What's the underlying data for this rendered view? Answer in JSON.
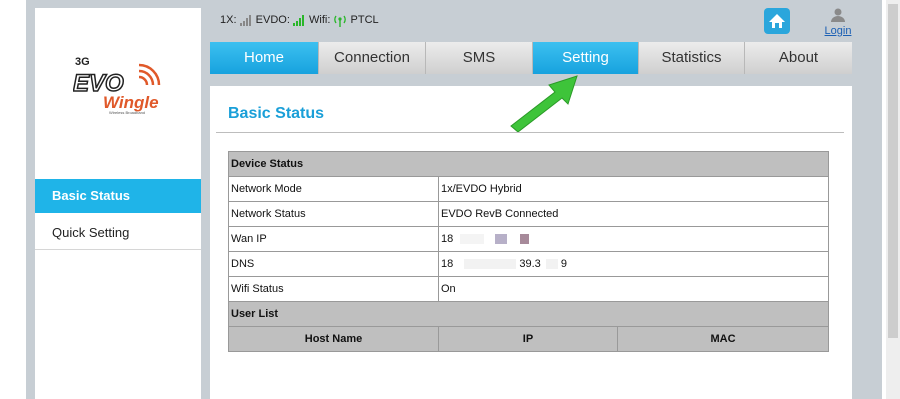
{
  "status": {
    "network_1x_label": "1X:",
    "evdo_label": "EVDO:",
    "wifi_label": "Wifi:",
    "operator": "PTCL",
    "login_label": "Login"
  },
  "logo": {
    "top_text": "3G",
    "main_text": "EVO",
    "sub_text": "Wingle",
    "tagline": "Wireless Broadband"
  },
  "sidebar": {
    "items": [
      {
        "label": "Basic Status"
      },
      {
        "label": "Quick Setting"
      }
    ]
  },
  "nav": {
    "tabs": [
      {
        "label": "Home"
      },
      {
        "label": "Connection"
      },
      {
        "label": "SMS"
      },
      {
        "label": "Setting"
      },
      {
        "label": "Statistics"
      },
      {
        "label": "About"
      }
    ]
  },
  "page": {
    "title": "Basic Status"
  },
  "device_status": {
    "section_title": "Device Status",
    "rows": [
      {
        "label": "Network Mode",
        "value": "1x/EVDO Hybrid"
      },
      {
        "label": "Network Status",
        "value": "EVDO RevB Connected"
      },
      {
        "label": "Wan IP",
        "value": "18"
      },
      {
        "label": "DNS",
        "value": "18",
        "value_part2": "39.3",
        "value_part3": "9"
      },
      {
        "label": "Wifi Status",
        "value": "On"
      }
    ]
  },
  "user_list": {
    "section_title": "User List",
    "columns": [
      "Host Name",
      "IP",
      "MAC"
    ]
  },
  "colors": {
    "accent": "#1fb4e8",
    "heading": "#1a9fd8",
    "arrow": "#3ec43a"
  }
}
